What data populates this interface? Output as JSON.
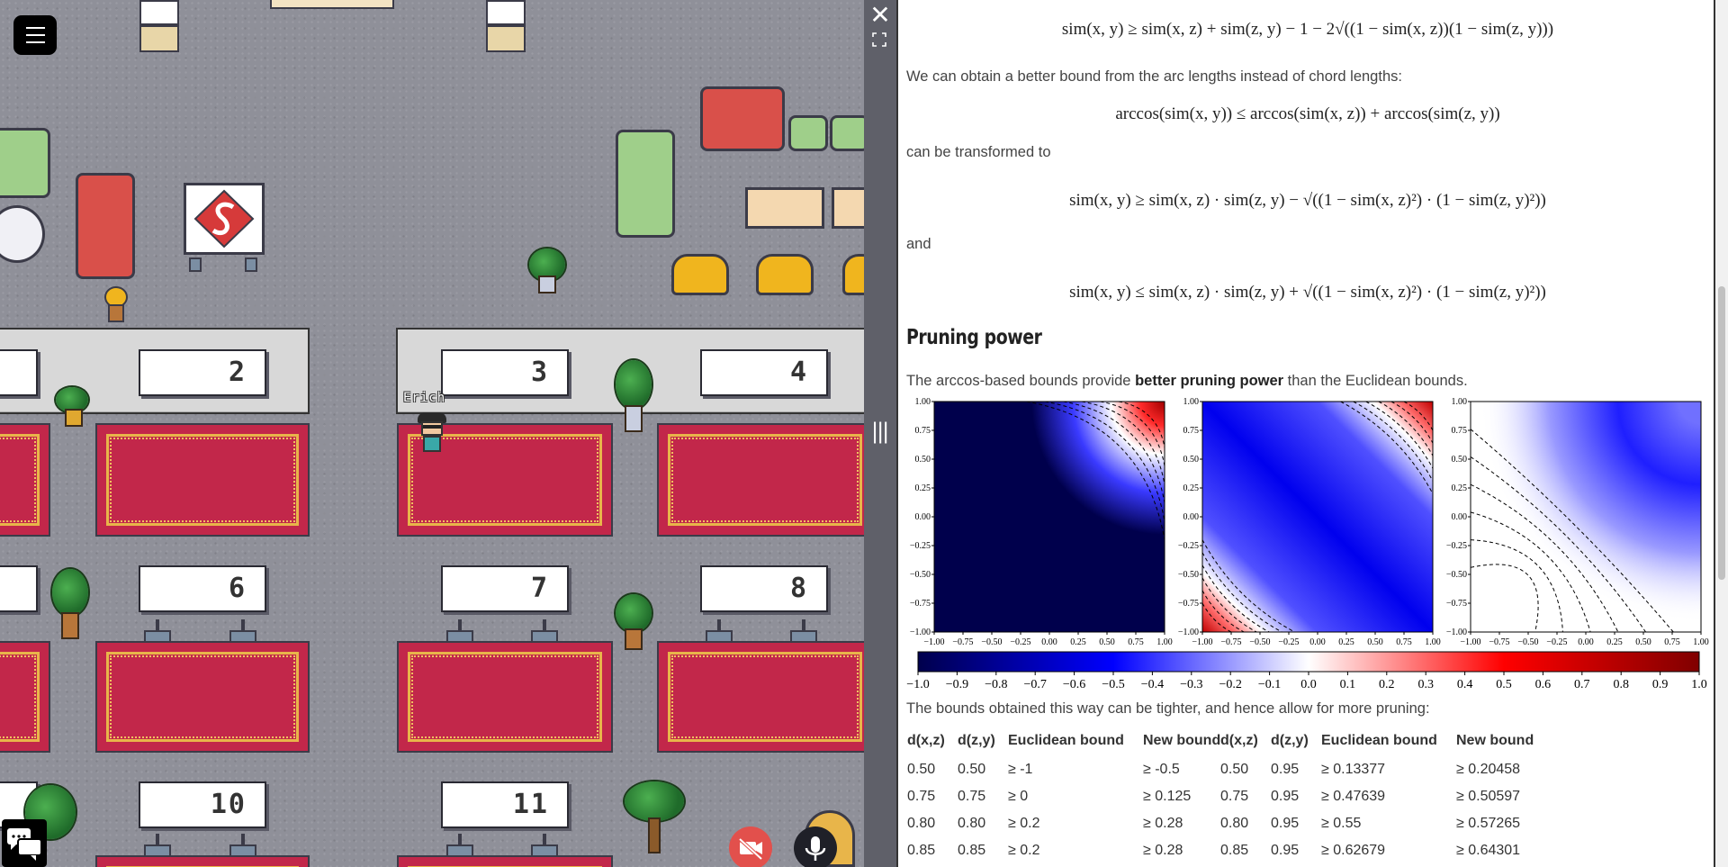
{
  "game": {
    "avatar_name": "Erich",
    "desk_numbers": [
      "2",
      "3",
      "4",
      "6",
      "7",
      "8",
      "10",
      "11"
    ]
  },
  "divider": {
    "close_glyph": "✕",
    "grip_glyph": "|||"
  },
  "doc": {
    "formula_top": "sim(x, y) ≥ sim(x, z) + sim(z, y) − 1 − 2√((1 − sim(x, z))(1 − sim(z, y)))",
    "para_arc": "We can obtain a better bound from the arc lengths instead of chord lengths:",
    "formula_arc": "arccos(sim(x, y)) ≤ arccos(sim(x, z)) + arccos(sim(z, y))",
    "para_transform": "can be transformed to",
    "formula_lower": "sim(x, y) ≥ sim(x, z) · sim(z, y) − √((1 − sim(x, z)²) · (1 − sim(z, y)²))",
    "para_and": "and",
    "formula_upper": "sim(x, y) ≤ sim(x, z) · sim(z, y) + √((1 − sim(x, z)²) · (1 − sim(z, y)²))",
    "heading": "Pruning power",
    "pruning_pre": "The arccos-based bounds provide ",
    "pruning_bold": "better pruning power",
    "pruning_post": " than the Euclidean bounds.",
    "para_tighter": "The bounds obtained this way can be tighter, and hence allow for more pruning:",
    "table_headers": [
      "d(x,z)",
      "d(z,y)",
      "Euclidean bound",
      "New bound",
      "d(x,z)",
      "d(z,y)",
      "Euclidean bound",
      "New bound"
    ],
    "table_rows": [
      [
        "0.50",
        "0.50",
        "≥ -1",
        "≥ -0.5",
        "0.50",
        "0.95",
        "≥ 0.13377",
        "≥ 0.20458"
      ],
      [
        "0.75",
        "0.75",
        "≥ 0",
        "≥ 0.125",
        "0.75",
        "0.95",
        "≥ 0.47639",
        "≥ 0.50597"
      ],
      [
        "0.80",
        "0.80",
        "≥ 0.2",
        "≥ 0.28",
        "0.80",
        "0.95",
        "≥ 0.55",
        "≥ 0.57265"
      ],
      [
        "0.85",
        "0.85",
        "≥ 0.2",
        "≥ 0.28",
        "0.85",
        "0.95",
        "≥ 0.62679",
        "≥ 0.64301"
      ]
    ]
  },
  "chart_data": [
    {
      "type": "heatmap",
      "title": "",
      "xlim": [
        -1.0,
        1.0
      ],
      "ylim": [
        -1.0,
        1.0
      ],
      "x_ticks": [
        "−1.00",
        "−0.75",
        "−0.50",
        "−0.25",
        "0.00",
        "0.25",
        "0.50",
        "0.75",
        "1.00"
      ],
      "y_ticks": [
        "1.00",
        "0.75",
        "0.50",
        "0.25",
        "0.00",
        "−0.25",
        "−0.50",
        "−0.75",
        "−1.00"
      ],
      "note_visual": "dark-blue field, red/white only near top-right corner"
    },
    {
      "type": "heatmap",
      "title": "",
      "xlim": [
        -1.0,
        1.0
      ],
      "ylim": [
        -1.0,
        1.0
      ],
      "x_ticks": [
        "−1.00",
        "−0.75",
        "−0.50",
        "−0.25",
        "0.00",
        "0.25",
        "0.50",
        "0.75",
        "1.00"
      ],
      "y_ticks": [
        "1.00",
        "0.75",
        "0.50",
        "0.25",
        "0.00",
        "−0.25",
        "−0.50",
        "−0.75",
        "−1.00"
      ],
      "note_visual": "blue field, red/white near top-right and bottom-left corners"
    },
    {
      "type": "heatmap",
      "title": "",
      "xlim": [
        -1.0,
        1.0
      ],
      "ylim": [
        -1.0,
        1.0
      ],
      "x_ticks": [
        "−1.00",
        "−0.75",
        "−0.50",
        "−0.25",
        "0.00",
        "0.25",
        "0.50",
        "0.75",
        "1.00"
      ],
      "y_ticks": [
        "1.00",
        "0.75",
        "0.50",
        "0.25",
        "0.00",
        "−0.25",
        "−0.50",
        "−0.75",
        "−1.00"
      ],
      "note_visual": "white diagonal band, blue toward top-right"
    },
    {
      "type": "colorbar",
      "range": [
        -1.0,
        1.0
      ],
      "tick_labels": [
        "−1.0",
        "−0.9",
        "−0.8",
        "−0.7",
        "−0.6",
        "−0.5",
        "−0.4",
        "−0.3",
        "−0.2",
        "−0.1",
        "0.0",
        "0.1",
        "0.2",
        "0.3",
        "0.4",
        "0.5",
        "0.6",
        "0.7",
        "0.8",
        "0.9",
        "1.0"
      ],
      "colormap": [
        "#00004c",
        "#0000ff",
        "#ffffff",
        "#ff0000",
        "#800000"
      ]
    }
  ]
}
